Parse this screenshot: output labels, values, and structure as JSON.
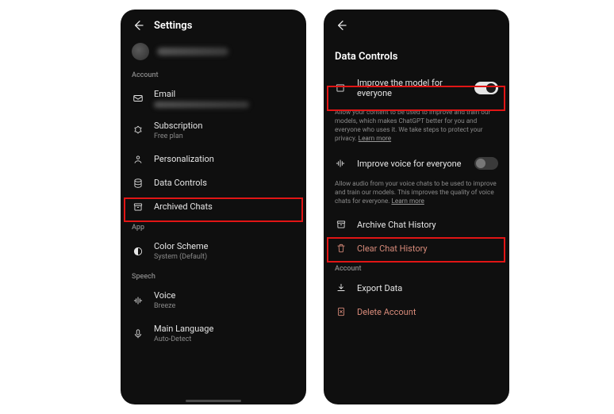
{
  "left": {
    "header_title": "Settings",
    "sections": {
      "account_label": "Account",
      "app_label": "App",
      "speech_label": "Speech"
    },
    "rows": {
      "email_label": "Email",
      "subscription_label": "Subscription",
      "subscription_sub": "Free plan",
      "personalization_label": "Personalization",
      "data_controls_label": "Data Controls",
      "archived_chats_label": "Archived Chats",
      "color_scheme_label": "Color Scheme",
      "color_scheme_sub": "System (Default)",
      "voice_label": "Voice",
      "voice_sub": "Breeze",
      "main_lang_label": "Main Language",
      "main_lang_sub": "Auto-Detect"
    }
  },
  "right": {
    "page_title": "Data Controls",
    "improve_model_label": "Improve the model for everyone",
    "improve_model_on": true,
    "improve_model_desc": "Allow your content to be used to improve and train our models, which makes ChatGPT better for you and everyone who uses it. We take steps to protect your privacy.",
    "improve_voice_label": "Improve voice for everyone",
    "improve_voice_on": false,
    "improve_voice_desc": "Allow audio from your voice chats to be used to improve and train our models. This improves the quality of voice chats for everyone.",
    "learn_more": "Learn more",
    "archive_history_label": "Archive Chat History",
    "clear_history_label": "Clear Chat History",
    "account_label": "Account",
    "export_label": "Export Data",
    "delete_account_label": "Delete Account"
  },
  "highlight_color": "#e11515"
}
